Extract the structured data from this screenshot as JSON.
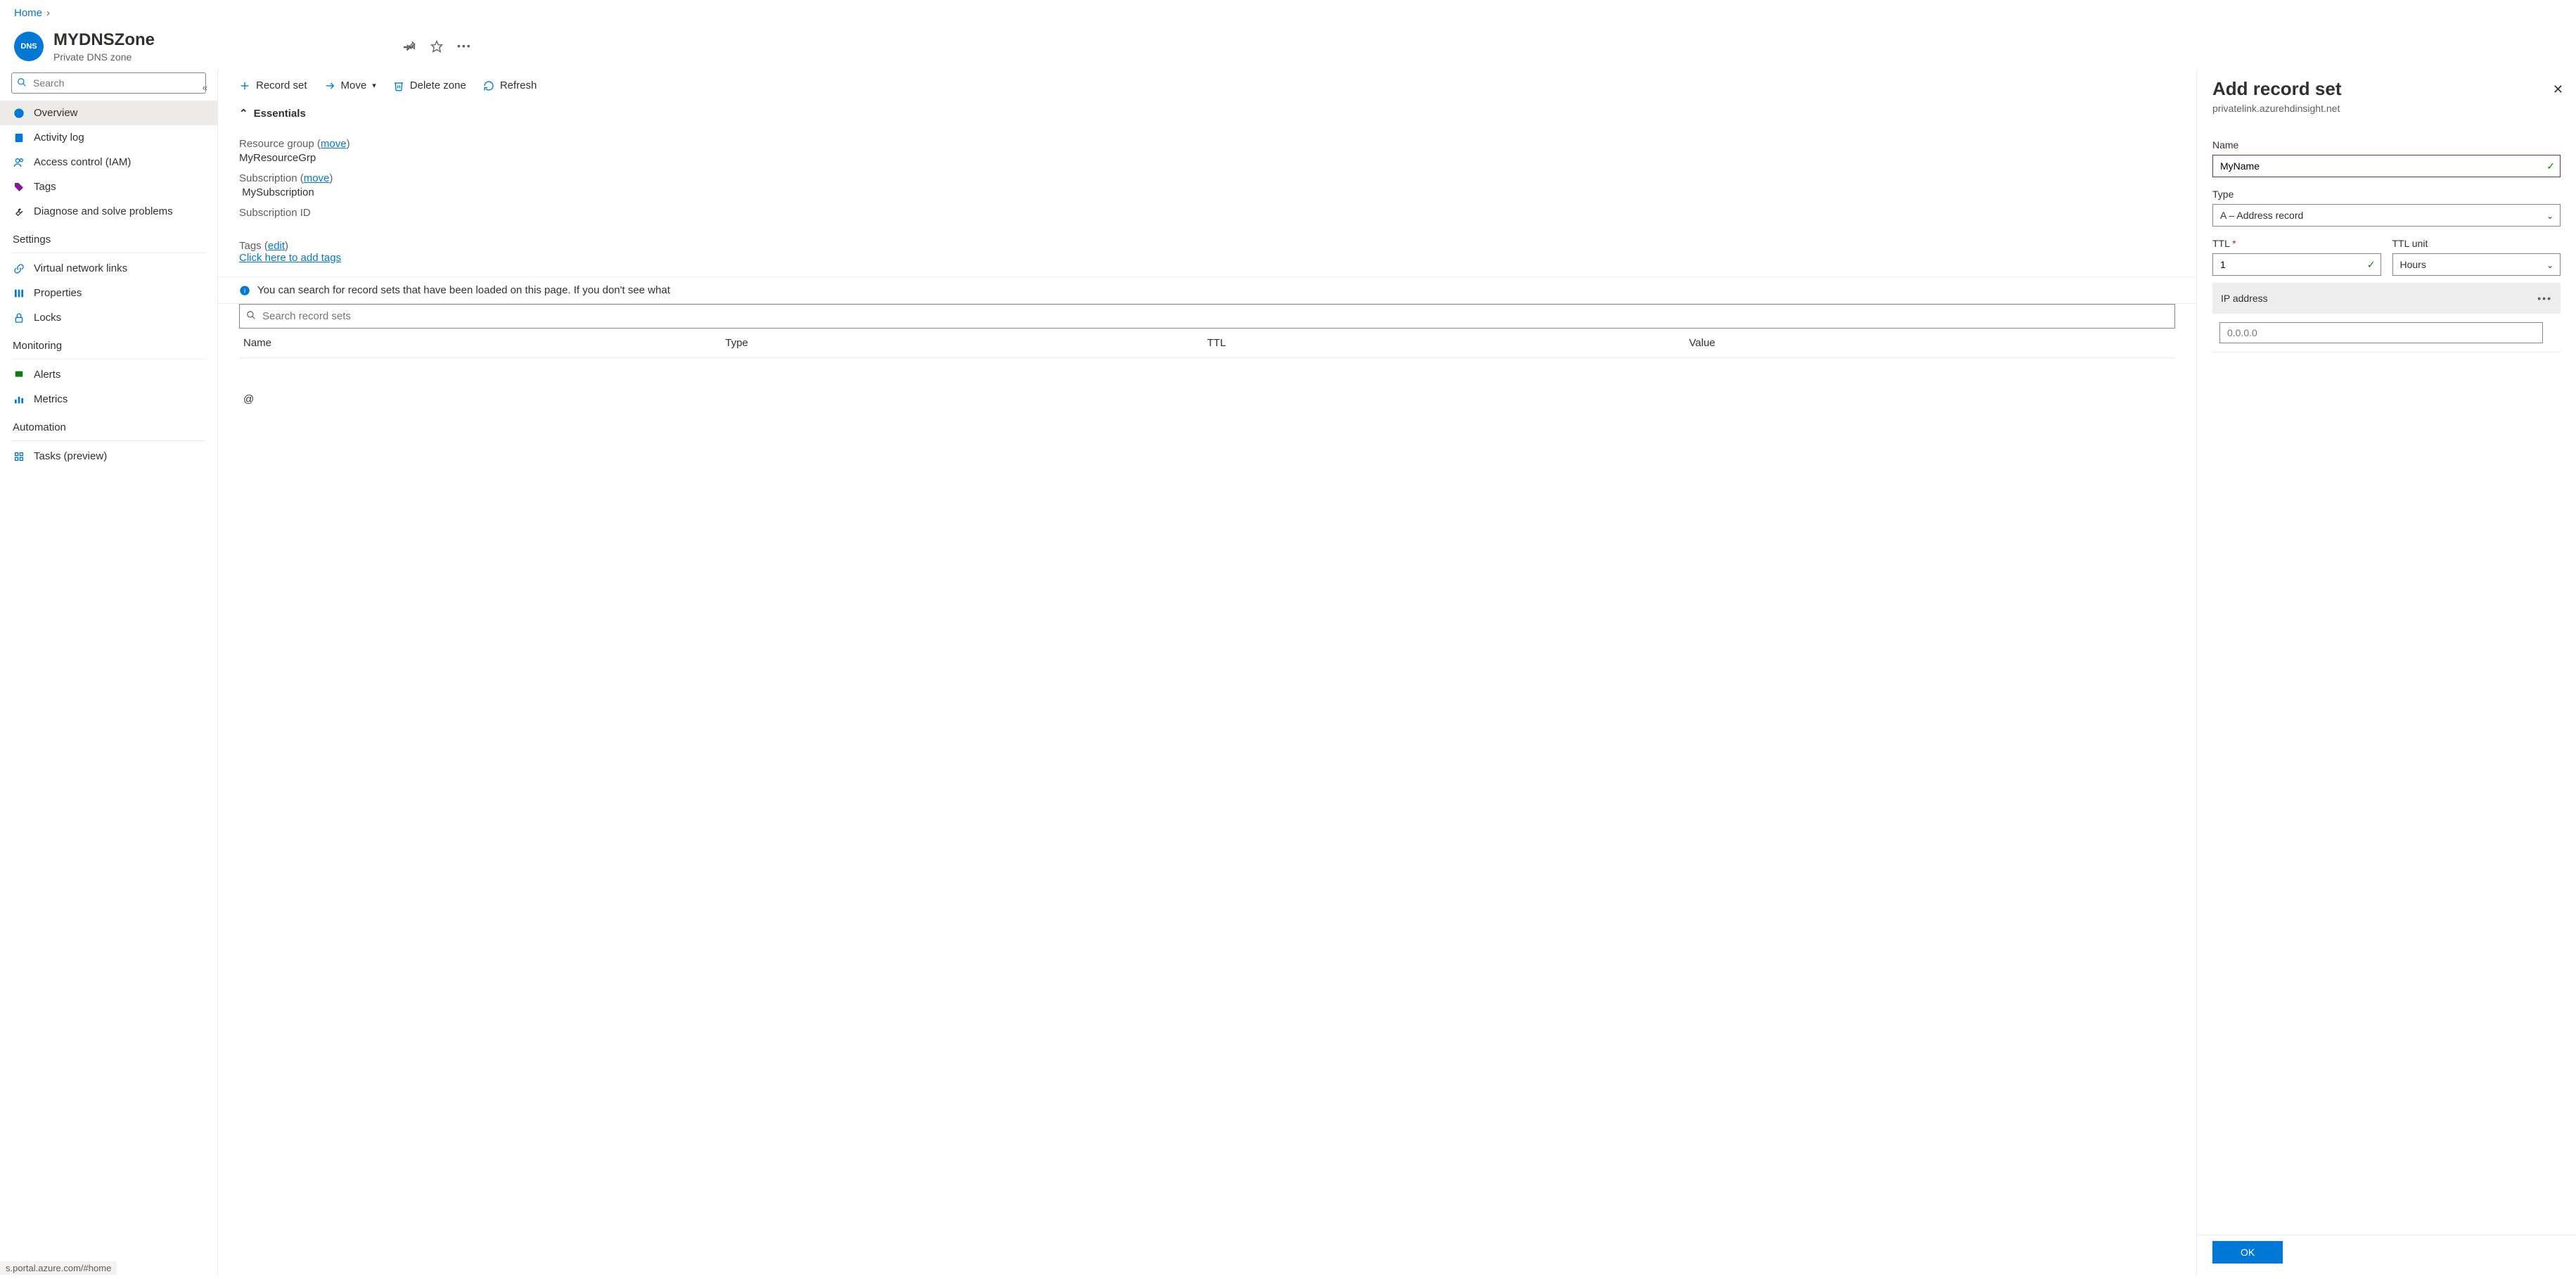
{
  "breadcrumb": {
    "home": "Home"
  },
  "header": {
    "badge": "DNS",
    "title": "MYDNSZone",
    "subtitle": "Private DNS zone"
  },
  "sidebar": {
    "search_placeholder": "Search",
    "items": {
      "overview": "Overview",
      "activity": "Activity log",
      "iam": "Access control (IAM)",
      "tags": "Tags",
      "diagnose": "Diagnose and solve problems"
    },
    "sections": {
      "settings": "Settings",
      "monitoring": "Monitoring",
      "automation": "Automation"
    },
    "settings_items": {
      "vnl": "Virtual network links",
      "props": "Properties",
      "locks": "Locks"
    },
    "monitoring_items": {
      "alerts": "Alerts",
      "metrics": "Metrics"
    },
    "automation_items": {
      "tasks": "Tasks (preview)"
    }
  },
  "toolbar": {
    "record_set": "Record set",
    "move": "Move",
    "delete": "Delete zone",
    "refresh": "Refresh"
  },
  "essentials": {
    "header": "Essentials",
    "rg_label": "Resource group",
    "rg_move": "move",
    "rg_value": "MyResourceGrp",
    "sub_label": "Subscription",
    "sub_move": "move",
    "sub_value": "MySubscription",
    "subid_label": "Subscription ID",
    "tags_label": "Tags",
    "tags_edit": "edit",
    "tags_add": "Click here to add tags"
  },
  "info_bar": "You can search for record sets that have been loaded on this page. If you don't see what",
  "record_search_placeholder": "Search record sets",
  "table": {
    "headers": {
      "name": "Name",
      "type": "Type",
      "ttl": "TTL",
      "value": "Value"
    },
    "row0_name": "@"
  },
  "status_url": "s.portal.azure.com/#home",
  "panel": {
    "title": "Add record set",
    "subtitle": "privatelink.azurehdinsight.net",
    "name_label": "Name",
    "name_value": "MyName",
    "type_label": "Type",
    "type_value": "A – Address record",
    "ttl_label": "TTL",
    "ttl_value": "1",
    "ttlunit_label": "TTL unit",
    "ttlunit_value": "Hours",
    "ip_label": "IP address",
    "ip_placeholder": "0.0.0.0",
    "ok": "OK"
  }
}
